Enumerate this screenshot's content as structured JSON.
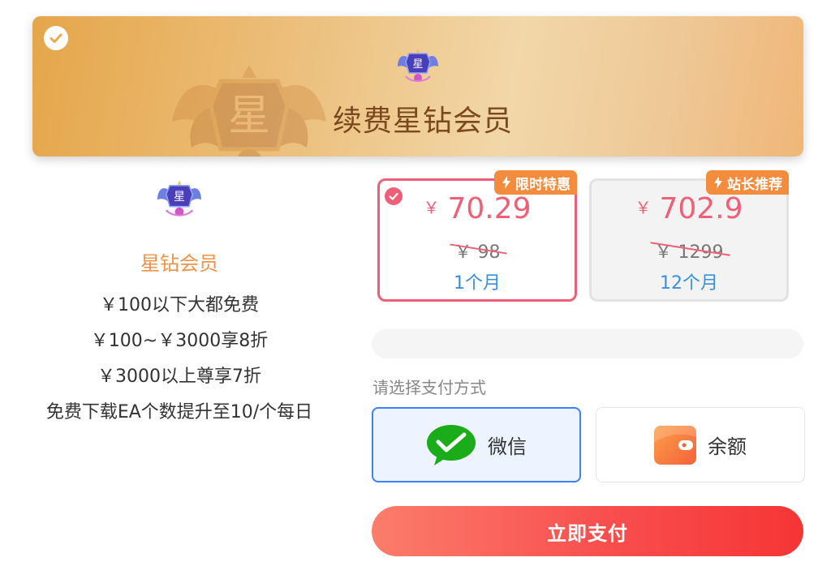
{
  "banner": {
    "title": "续费星钻会员",
    "emblem_text": "星",
    "icons": {
      "selected": "check-circle-icon",
      "emblem": "star-diamond-badge-icon"
    }
  },
  "member": {
    "name": "星钻会员",
    "emblem_text": "星",
    "benefits": [
      "￥100以下大都免费",
      "￥100~￥3000享8折",
      "￥3000以上尊享7折",
      "免费下载EA个数提升至10/个每日"
    ]
  },
  "plans": [
    {
      "badge": "限时特惠",
      "currency": "￥",
      "price": "70.29",
      "original": "￥ 98",
      "period": "1个月",
      "selected": true
    },
    {
      "badge": "站长推荐",
      "currency": "￥",
      "price": "702.9",
      "original": "￥ 1299",
      "period": "12个月",
      "selected": false
    }
  ],
  "payment": {
    "label": "请选择支付方式",
    "methods": [
      {
        "label": "微信",
        "icon": "wechat-icon",
        "selected": true
      },
      {
        "label": "余额",
        "icon": "wallet-icon",
        "selected": false
      }
    ]
  },
  "pay_button": "立即支付",
  "colors": {
    "accent_red": "#f05f78",
    "badge_orange": "#f48c3e",
    "period_blue": "#3a8fe0",
    "wechat_green": "#1aad19",
    "member_orange": "#f0934a"
  }
}
